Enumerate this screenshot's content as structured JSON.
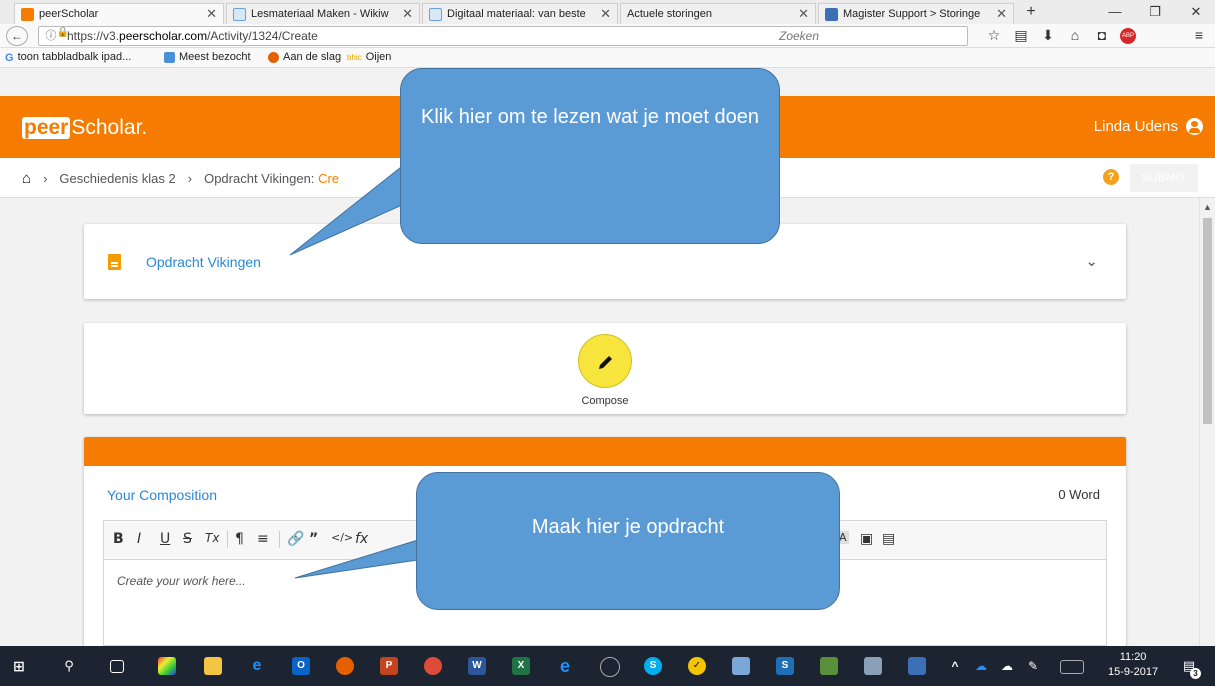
{
  "browser": {
    "tabs": [
      {
        "title": "peerScholar",
        "active": true
      },
      {
        "title": "Lesmateriaal Maken - Wikiw"
      },
      {
        "title": "Digitaal materiaal: van beste"
      },
      {
        "title": "Actuele storingen"
      },
      {
        "title": "Magister Support > Storinge"
      }
    ],
    "url_prefix": "https://v3.",
    "url_domain": "peerscholar.com",
    "url_path": "/Activity/1324/Create",
    "search_placeholder": "Zoeken",
    "bookmarks": [
      "toon tabbladbalk ipad...",
      "Meest bezocht",
      "Aan de slag",
      "Oijen"
    ],
    "bookmark_icons": [
      "google-icon",
      "globe-icon",
      "firefox-icon",
      "bhic-icon"
    ]
  },
  "app": {
    "logo_a": "peer",
    "logo_b": "Scholar.",
    "user": "Linda Udens",
    "breadcrumb": [
      "Geschiedenis klas 2",
      "Opdracht Vikingen:"
    ],
    "breadcrumb_current": "Cre",
    "help": "?",
    "submit": "SUBMIT"
  },
  "assignment": {
    "title": "Opdracht Vikingen"
  },
  "compose": {
    "label": "Compose"
  },
  "editor": {
    "title": "Your Composition",
    "word_count": "0 Word",
    "placeholder": "Create your work here...",
    "toolbar": [
      "B",
      "I",
      "U",
      "S",
      "Tx",
      "¶",
      "≡",
      "link",
      "quote",
      "code",
      "fx",
      "A",
      "image",
      "video"
    ]
  },
  "callouts": {
    "top": "Klik hier om te lezen wat je moet doen",
    "bottom": "Maak hier je opdracht"
  },
  "taskbar": {
    "time": "11:20",
    "date": "15-9-2017",
    "notification_count": "3"
  },
  "colors": {
    "orange": "#f57c00",
    "link": "#2a88d8",
    "callout": "#5b9bd5",
    "compose": "#f7e43c"
  }
}
